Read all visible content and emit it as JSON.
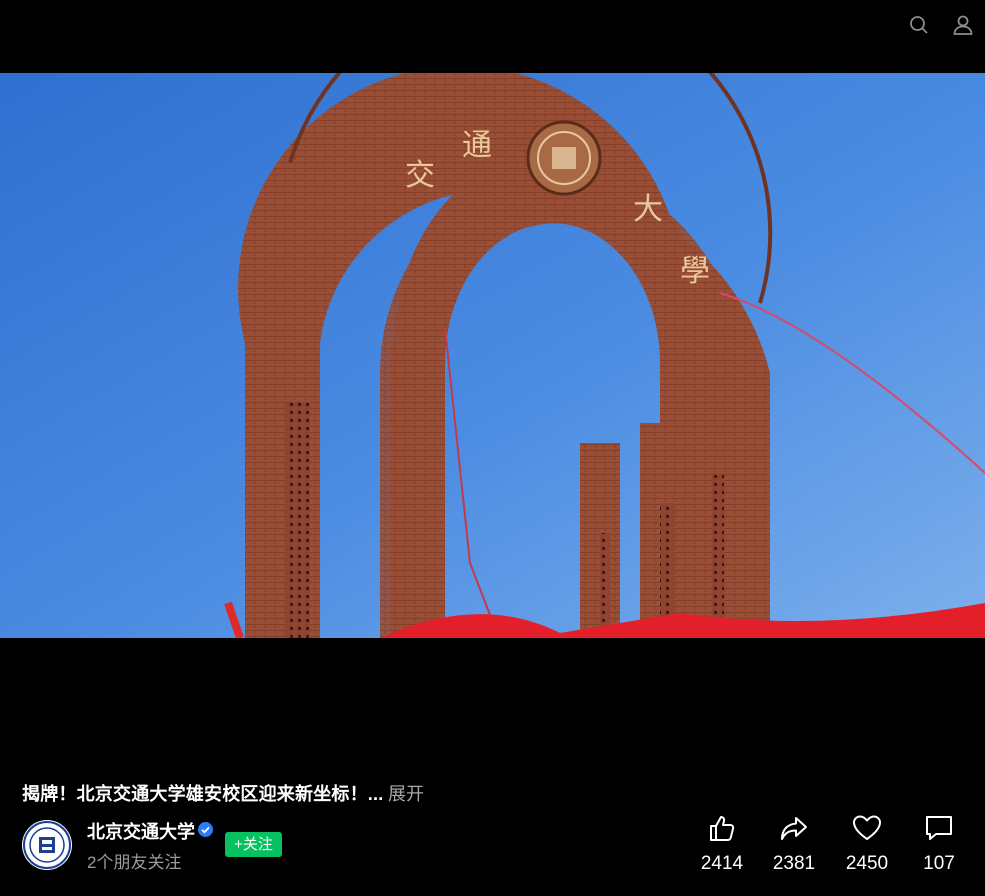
{
  "header": {
    "search_icon": "search-icon",
    "profile_icon": "user-icon"
  },
  "video": {
    "arch_inscription": [
      "交",
      "通",
      "大",
      "學"
    ]
  },
  "post": {
    "caption": "揭牌！北京交通大学雄安校区迎来新坐标！...",
    "expand_label": "展开"
  },
  "account": {
    "name": "北京交通大学",
    "verified_icon": "verified-badge-icon",
    "friends_following": "2个朋友关注",
    "follow_label": "+关注"
  },
  "actions": {
    "like": {
      "icon": "thumbs-up-icon",
      "count": "2414"
    },
    "share": {
      "icon": "share-arrow-icon",
      "count": "2381"
    },
    "favorite": {
      "icon": "heart-icon",
      "count": "2450"
    },
    "comment": {
      "icon": "comment-icon",
      "count": "107"
    }
  },
  "colors": {
    "background": "#000000",
    "follow_button": "#07c160",
    "verified": "#2b7cf6",
    "sky": "#4a8ae0",
    "brick": "#9c4f36"
  }
}
